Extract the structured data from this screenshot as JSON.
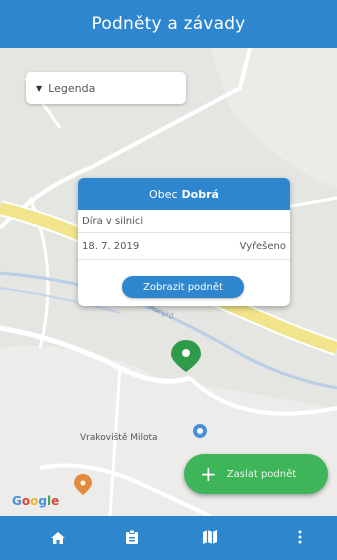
{
  "header": {
    "title": "Podněty a závady"
  },
  "legend": {
    "label": "Legenda"
  },
  "popup": {
    "title_prefix": "Obec",
    "title_name": "Dobrá",
    "issue": "Díra v silnici",
    "date": "18. 7. 2019",
    "status": "Vyřešeno",
    "button_label": "Zobrazit podnět"
  },
  "map": {
    "place_label": "Vrakoviště Milota",
    "road_label": "Pionýrů",
    "google_logo": "Google",
    "road_color": "#f2e48a"
  },
  "fab": {
    "label": "Zaslat podnět"
  },
  "nav": {
    "items": [
      {
        "icon": "home-icon"
      },
      {
        "icon": "clipboard-icon"
      },
      {
        "icon": "map-icon"
      },
      {
        "icon": "more-vertical-icon"
      }
    ]
  },
  "colors": {
    "primary": "#2e86cf",
    "accent_green": "#3fb55a"
  }
}
